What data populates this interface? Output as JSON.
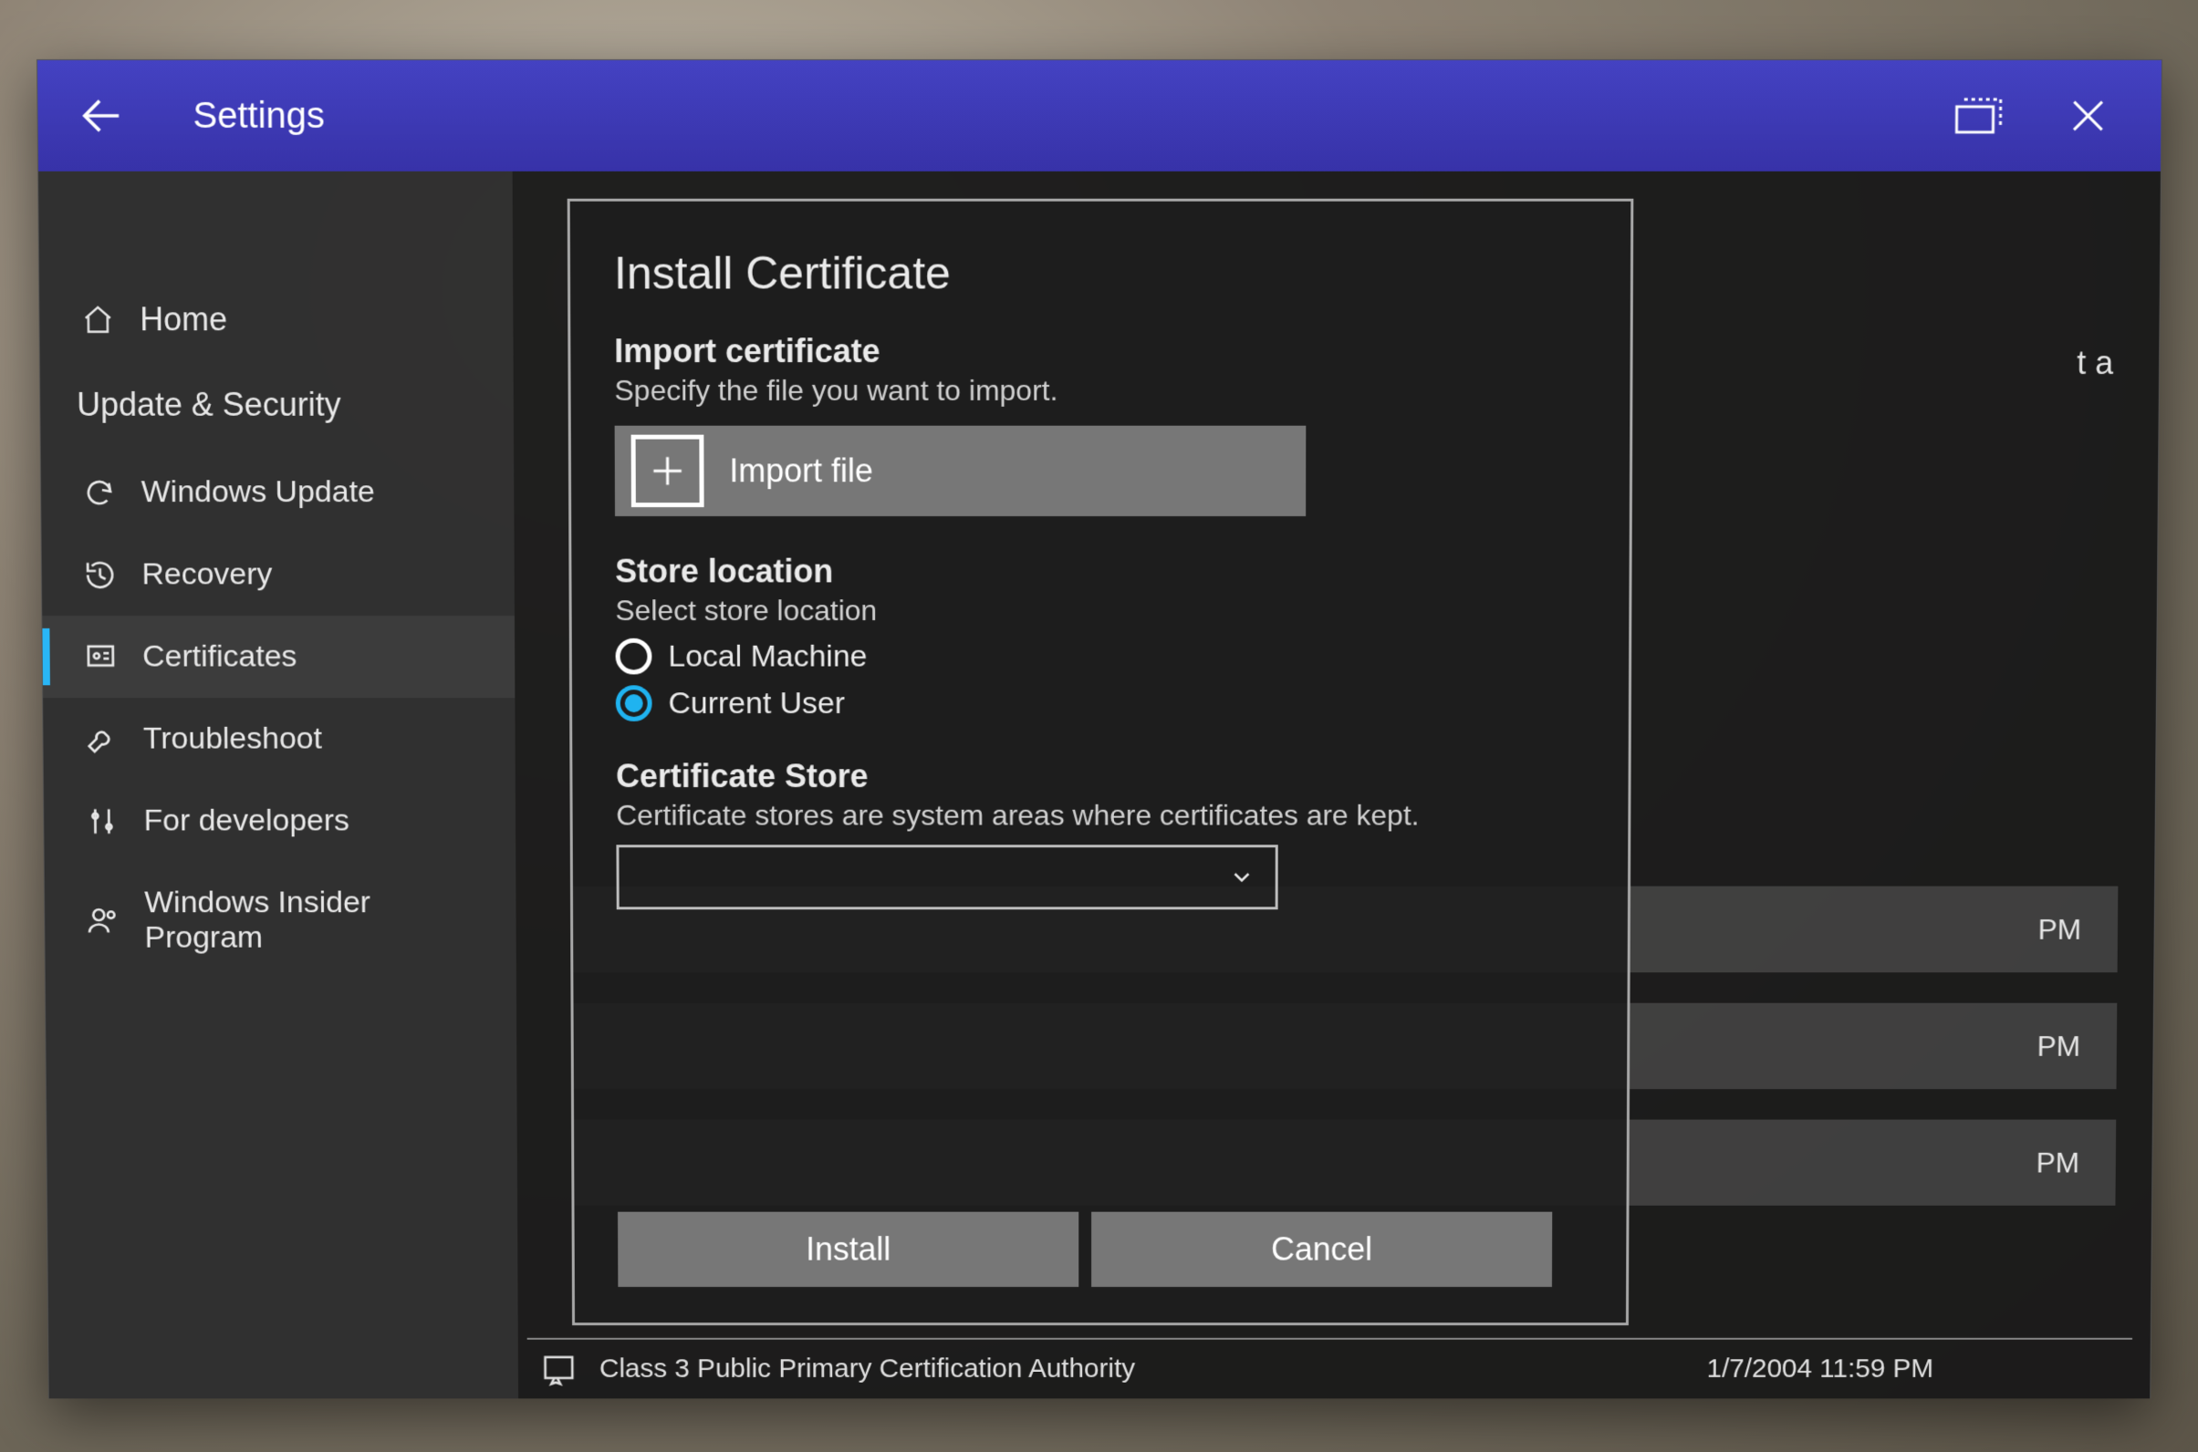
{
  "titlebar": {
    "title": "Settings"
  },
  "sidebar": {
    "home": "Home",
    "section": "Update & Security",
    "items": [
      {
        "label": "Windows Update"
      },
      {
        "label": "Recovery"
      },
      {
        "label": "Certificates"
      },
      {
        "label": "Troubleshoot"
      },
      {
        "label": "For developers"
      },
      {
        "label": "Windows Insider\nProgram"
      }
    ]
  },
  "dialog": {
    "title": "Install Certificate",
    "import": {
      "heading": "Import certificate",
      "sub": "Specify the file you want to import.",
      "button": "Import file"
    },
    "store_location": {
      "heading": "Store location",
      "sub": "Select store location",
      "options": {
        "local": "Local Machine",
        "user": "Current User"
      },
      "selected": "user"
    },
    "cert_store": {
      "heading": "Certificate Store",
      "sub": "Certificate stores are system areas where certificates are kept.",
      "value": ""
    },
    "actions": {
      "install": "Install",
      "cancel": "Cancel"
    }
  },
  "background": {
    "partial_text": "t a",
    "row_ts": "PM",
    "bottom_row": {
      "name": "Class 3 Public Primary Certification Authority",
      "ts": "1/7/2004 11:59 PM"
    }
  }
}
